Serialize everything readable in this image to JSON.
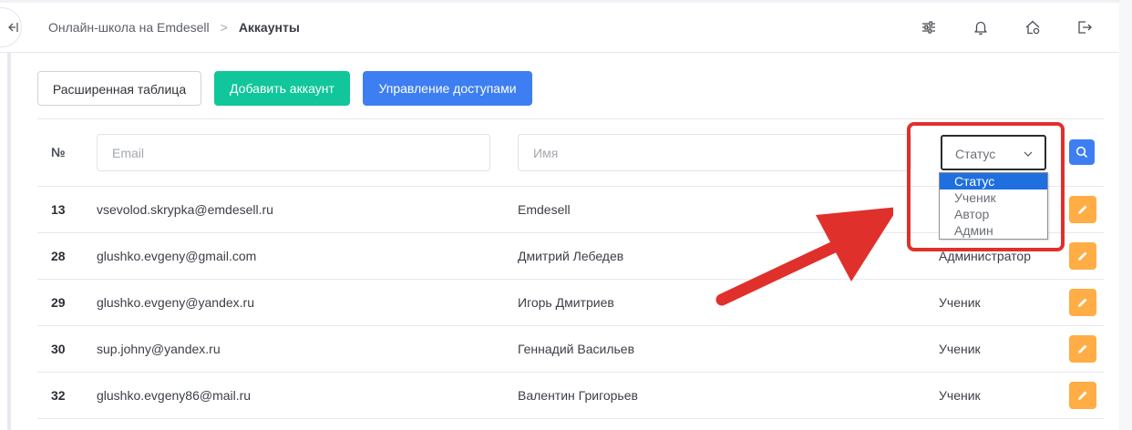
{
  "header": {
    "breadcrumb": {
      "root": "Онлайн-школа на Emdesell",
      "separator": ">",
      "current": "Аккаунты"
    },
    "icons": [
      "sliders-icon",
      "bell-icon",
      "home-settings-icon",
      "logout-icon"
    ]
  },
  "toolbar": {
    "extended_table_label": "Расширенная таблица",
    "add_account_label": "Добавить аккаунт",
    "manage_access_label": "Управление доступами"
  },
  "filters": {
    "number_header": "№",
    "email_placeholder": "Email",
    "name_placeholder": "Имя",
    "status_selected": "Статус"
  },
  "status_dropdown": {
    "options": [
      "Статус",
      "Ученик",
      "Автор",
      "Админ"
    ],
    "selected_index": 0
  },
  "rows": [
    {
      "id": "13",
      "email": "vsevolod.skrypka@emdesell.ru",
      "name": "Emdesell",
      "status": ""
    },
    {
      "id": "28",
      "email": "glushko.evgeny@gmail.com",
      "name": "Дмитрий Лебедев",
      "status": "Администратор"
    },
    {
      "id": "29",
      "email": "glushko.evgeny@yandex.ru",
      "name": "Игорь Дмитриев",
      "status": "Ученик"
    },
    {
      "id": "30",
      "email": "sup.johny@yandex.ru",
      "name": "Геннадий Васильев",
      "status": "Ученик"
    },
    {
      "id": "32",
      "email": "glushko.evgeny86@mail.ru",
      "name": "Валентин Григорьев",
      "status": "Ученик"
    }
  ],
  "colors": {
    "green_button": "#10c69a",
    "blue_button": "#3d7ff2",
    "edit_button": "#ffad44",
    "annotation_red": "#e0302b",
    "dropdown_selected": "#1f6fe0"
  }
}
